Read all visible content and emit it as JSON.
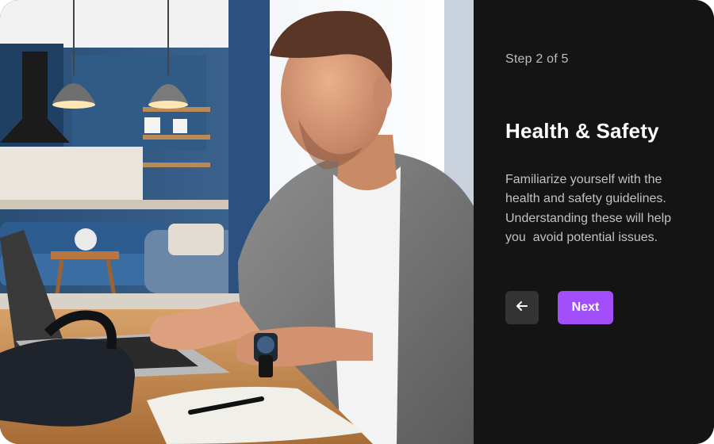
{
  "onboarding": {
    "step_label": "Step 2 of 5",
    "title": "Health & Safety",
    "description": "Familiarize yourself with the health and safety guidelines. Understanding these will help you  avoid potential issues.",
    "back_icon": "arrow-left-icon",
    "next_label": "Next"
  },
  "hero_image": {
    "subject": "man using a laptop at a desk with a VR headset and notebook",
    "icon": "photo"
  },
  "colors": {
    "panel_background": "#141414",
    "accent": "#a24ffb",
    "back_button_background": "#333333",
    "title_text": "#ffffff",
    "body_text": "#c2c2c2",
    "step_text": "#bdbdbd"
  }
}
